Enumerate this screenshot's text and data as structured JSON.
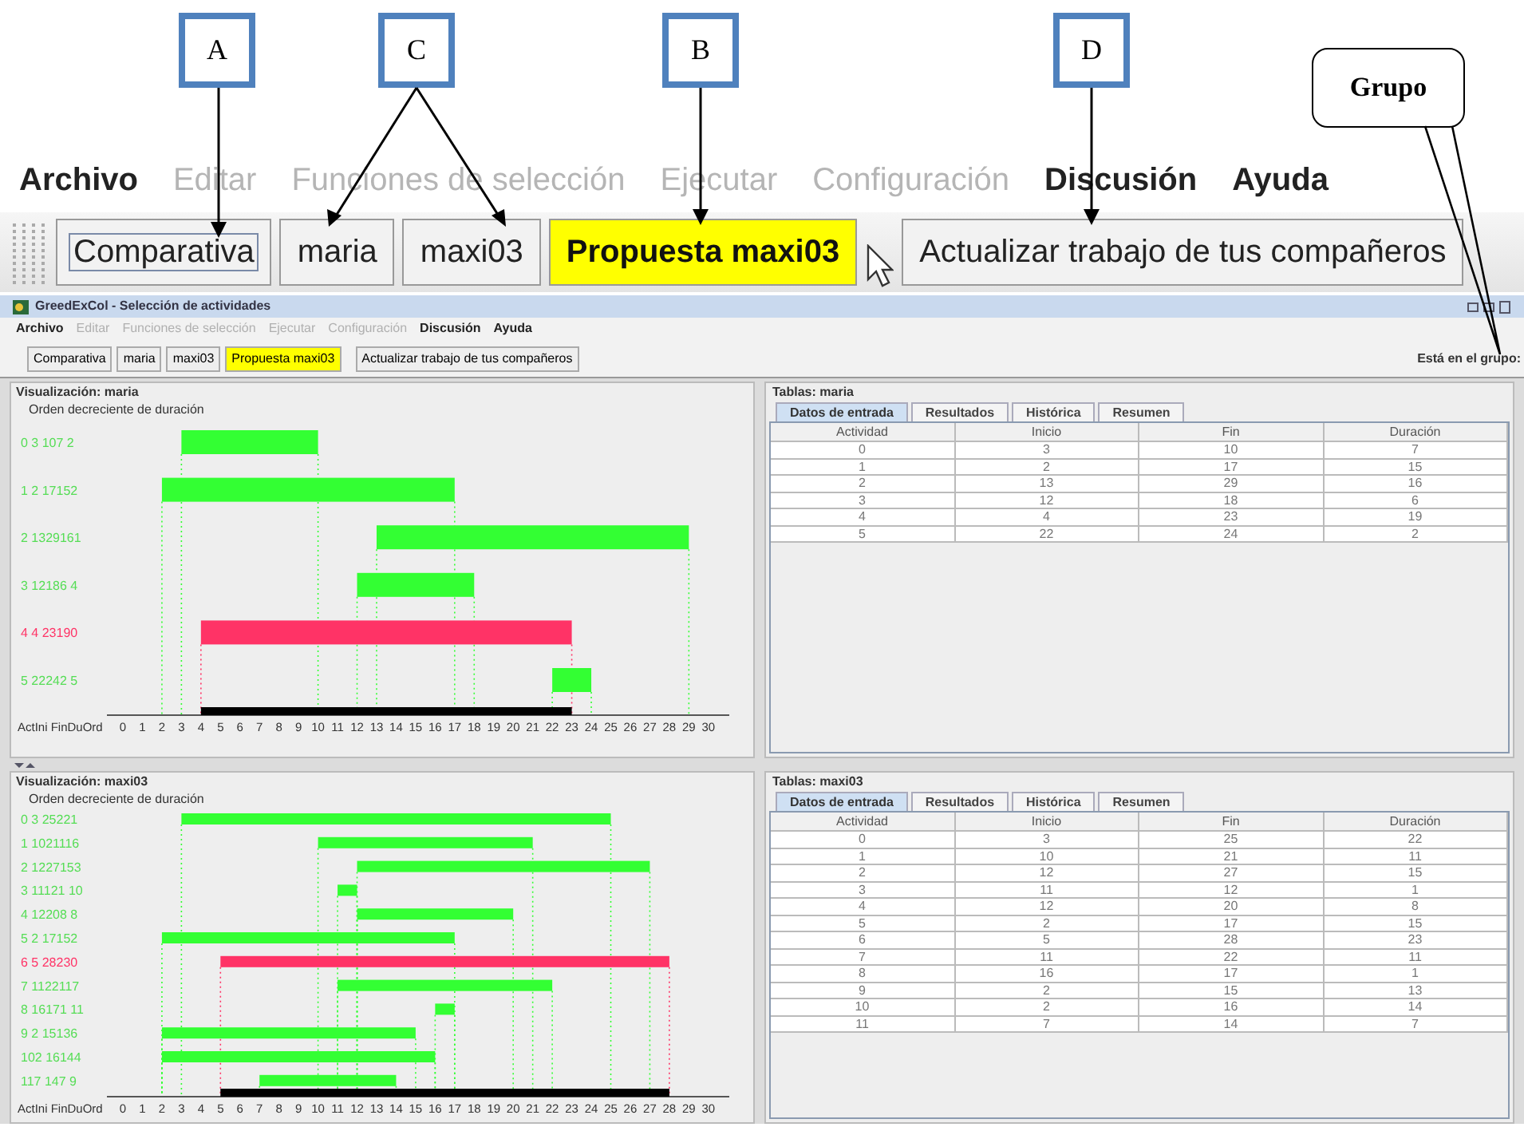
{
  "annotations": [
    {
      "label": "A"
    },
    {
      "label": "C"
    },
    {
      "label": "B"
    },
    {
      "label": "D"
    },
    {
      "label": "Grupo"
    }
  ],
  "enlarged_menu": [
    {
      "label": "Archivo",
      "enabled": true
    },
    {
      "label": "Editar",
      "enabled": false
    },
    {
      "label": "Funciones de selección",
      "enabled": false
    },
    {
      "label": "Ejecutar",
      "enabled": false
    },
    {
      "label": "Configuración",
      "enabled": false
    },
    {
      "label": "Discusión",
      "enabled": true
    },
    {
      "label": "Ayuda",
      "enabled": true
    }
  ],
  "enlarged_toolbar": [
    {
      "label": "Comparativa",
      "selected": false,
      "focused": true
    },
    {
      "label": "maria",
      "selected": false,
      "focused": false
    },
    {
      "label": "maxi03",
      "selected": false,
      "focused": false
    },
    {
      "label": "Propuesta maxi03",
      "selected": true,
      "focused": false
    },
    {
      "label": "Actualizar trabajo de tus compañeros",
      "selected": false,
      "focused": false
    }
  ],
  "window": {
    "title": "GreedExCol - Selección de actividades"
  },
  "menu": [
    {
      "label": "Archivo",
      "enabled": true
    },
    {
      "label": "Editar",
      "enabled": false
    },
    {
      "label": "Funciones de selección",
      "enabled": false
    },
    {
      "label": "Ejecutar",
      "enabled": false
    },
    {
      "label": "Configuración",
      "enabled": false
    },
    {
      "label": "Discusión",
      "enabled": true
    },
    {
      "label": "Ayuda",
      "enabled": true
    }
  ],
  "toolbar": [
    {
      "label": "Comparativa",
      "selected": false
    },
    {
      "label": "maria",
      "selected": false
    },
    {
      "label": "maxi03",
      "selected": false
    },
    {
      "label": "Propuesta maxi03",
      "selected": true
    },
    {
      "label": "Actualizar trabajo de tus compañeros",
      "selected": false
    }
  ],
  "group_label": "Está en el grupo:",
  "panels": [
    {
      "visualization": {
        "title": "Visualización: maria",
        "subtitle": "Orden decreciente de duración",
        "axis_label": "ActIni FinDuOrd",
        "rows": [
          {
            "label": "0 3 107 2",
            "selected": false
          },
          {
            "label": "1 2 17152",
            "selected": false
          },
          {
            "label": "2 1329161",
            "selected": false
          },
          {
            "label": "3 12186 4",
            "selected": false
          },
          {
            "label": "4 4 23190",
            "selected": true
          },
          {
            "label": "5 22242 5",
            "selected": false
          }
        ],
        "ticks": [
          "0",
          "1",
          "2",
          "3",
          "4",
          "5",
          "6",
          "7",
          "8",
          "9",
          "10",
          "11",
          "12",
          "13",
          "14",
          "15",
          "16",
          "17",
          "18",
          "19",
          "20",
          "21",
          "22",
          "23",
          "24",
          "25",
          "26",
          "27",
          "28",
          "29",
          "30"
        ]
      },
      "tables": {
        "title": "Tablas: maria",
        "tabs": [
          {
            "label": "Datos de entrada",
            "selected": true
          },
          {
            "label": "Resultados",
            "selected": false
          },
          {
            "label": "Histórica",
            "selected": false
          },
          {
            "label": "Resumen",
            "selected": false
          }
        ],
        "columns": [
          "Actividad",
          "Inicio",
          "Fin",
          "Duración"
        ],
        "rows": [
          [
            "0",
            "3",
            "10",
            "7"
          ],
          [
            "1",
            "2",
            "17",
            "15"
          ],
          [
            "2",
            "13",
            "29",
            "16"
          ],
          [
            "3",
            "12",
            "18",
            "6"
          ],
          [
            "4",
            "4",
            "23",
            "19"
          ],
          [
            "5",
            "22",
            "24",
            "2"
          ]
        ]
      }
    },
    {
      "visualization": {
        "title": "Visualización: maxi03",
        "subtitle": "Orden decreciente de duración",
        "axis_label": "ActIni FinDuOrd",
        "rows": [
          {
            "label": "0 3 25221",
            "selected": false
          },
          {
            "label": "1 1021116",
            "selected": false
          },
          {
            "label": "2 1227153",
            "selected": false
          },
          {
            "label": "3 11121 10",
            "selected": false
          },
          {
            "label": "4 12208 8",
            "selected": false
          },
          {
            "label": "5 2 17152",
            "selected": false
          },
          {
            "label": "6 5 28230",
            "selected": true
          },
          {
            "label": "7 1122117",
            "selected": false
          },
          {
            "label": "8 16171 11",
            "selected": false
          },
          {
            "label": "9 2 15136",
            "selected": false
          },
          {
            "label": "102 16144",
            "selected": false
          },
          {
            "label": "117 147 9",
            "selected": false
          }
        ],
        "ticks": [
          "0",
          "1",
          "2",
          "3",
          "4",
          "5",
          "6",
          "7",
          "8",
          "9",
          "10",
          "11",
          "12",
          "13",
          "14",
          "15",
          "16",
          "17",
          "18",
          "19",
          "20",
          "21",
          "22",
          "23",
          "24",
          "25",
          "26",
          "27",
          "28",
          "29",
          "30"
        ]
      },
      "tables": {
        "title": "Tablas: maxi03",
        "tabs": [
          {
            "label": "Datos de entrada",
            "selected": true
          },
          {
            "label": "Resultados",
            "selected": false
          },
          {
            "label": "Histórica",
            "selected": false
          },
          {
            "label": "Resumen",
            "selected": false
          }
        ],
        "columns": [
          "Actividad",
          "Inicio",
          "Fin",
          "Duración"
        ],
        "rows": [
          [
            "0",
            "3",
            "25",
            "22"
          ],
          [
            "1",
            "10",
            "21",
            "11"
          ],
          [
            "2",
            "12",
            "27",
            "15"
          ],
          [
            "3",
            "11",
            "12",
            "1"
          ],
          [
            "4",
            "12",
            "20",
            "8"
          ],
          [
            "5",
            "2",
            "17",
            "15"
          ],
          [
            "6",
            "5",
            "28",
            "23"
          ],
          [
            "7",
            "11",
            "22",
            "11"
          ],
          [
            "8",
            "16",
            "17",
            "1"
          ],
          [
            "9",
            "2",
            "15",
            "13"
          ],
          [
            "10",
            "2",
            "16",
            "14"
          ],
          [
            "11",
            "7",
            "14",
            "7"
          ]
        ]
      }
    }
  ]
}
